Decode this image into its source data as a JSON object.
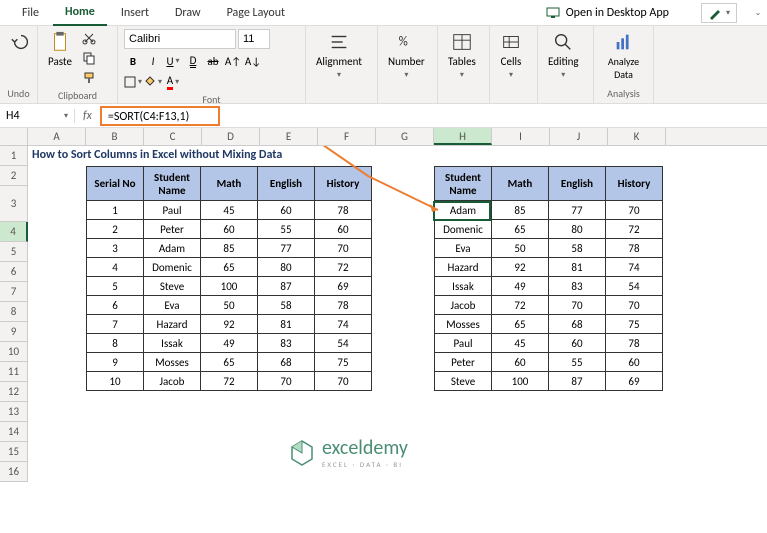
{
  "tabs": [
    "File",
    "Home",
    "Insert",
    "Draw",
    "Page Layout"
  ],
  "active_tab": "Home",
  "desktop_app": "Open in Desktop App",
  "ribbon": {
    "undo": "Undo",
    "clipboard": "Clipboard",
    "paste": "Paste",
    "font_group": "Font",
    "font_name": "Calibri",
    "font_size": "11",
    "alignment": "Alignment",
    "number": "Number",
    "tables": "Tables",
    "cells": "Cells",
    "editing": "Editing",
    "analyze": "Analyze Data",
    "analysis": "Analysis"
  },
  "name_box": "H4",
  "fx": "fx",
  "formula": "=SORT(C4:F13,1)",
  "columns": [
    "A",
    "B",
    "C",
    "D",
    "E",
    "F",
    "G",
    "H",
    "I",
    "J",
    "K"
  ],
  "rows": [
    "1",
    "2",
    "3",
    "4",
    "5",
    "6",
    "7",
    "8",
    "9",
    "10",
    "11",
    "12",
    "13",
    "14",
    "15",
    "16"
  ],
  "title": "How to Sort Columns in Excel without Mixing Data",
  "left_headers": [
    "Serial No",
    "Student Name",
    "Math",
    "English",
    "History"
  ],
  "right_headers": [
    "Student Name",
    "Math",
    "English",
    "History"
  ],
  "left_data": [
    [
      "1",
      "Paul",
      "45",
      "60",
      "78"
    ],
    [
      "2",
      "Peter",
      "60",
      "55",
      "60"
    ],
    [
      "3",
      "Adam",
      "85",
      "77",
      "70"
    ],
    [
      "4",
      "Domenic",
      "65",
      "80",
      "72"
    ],
    [
      "5",
      "Steve",
      "100",
      "87",
      "69"
    ],
    [
      "6",
      "Eva",
      "50",
      "58",
      "78"
    ],
    [
      "7",
      "Hazard",
      "92",
      "81",
      "74"
    ],
    [
      "8",
      "Issak",
      "49",
      "83",
      "54"
    ],
    [
      "9",
      "Mosses",
      "65",
      "68",
      "75"
    ],
    [
      "10",
      "Jacob",
      "72",
      "70",
      "70"
    ]
  ],
  "right_data": [
    [
      "Adam",
      "85",
      "77",
      "70"
    ],
    [
      "Domenic",
      "65",
      "80",
      "72"
    ],
    [
      "Eva",
      "50",
      "58",
      "78"
    ],
    [
      "Hazard",
      "92",
      "81",
      "74"
    ],
    [
      "Issak",
      "49",
      "83",
      "54"
    ],
    [
      "Jacob",
      "72",
      "70",
      "70"
    ],
    [
      "Mosses",
      "65",
      "68",
      "75"
    ],
    [
      "Paul",
      "45",
      "60",
      "78"
    ],
    [
      "Peter",
      "60",
      "55",
      "60"
    ],
    [
      "Steve",
      "100",
      "87",
      "69"
    ]
  ],
  "logo": {
    "name": "exceldemy",
    "sub": "EXCEL · DATA · BI"
  },
  "chart_data": {
    "type": "table",
    "title": "How to Sort Columns in Excel without Mixing Data",
    "source_range": "C4:F13",
    "formula": "=SORT(C4:F13,1)",
    "original": {
      "columns": [
        "Serial No",
        "Student Name",
        "Math",
        "English",
        "History"
      ],
      "rows": [
        [
          1,
          "Paul",
          45,
          60,
          78
        ],
        [
          2,
          "Peter",
          60,
          55,
          60
        ],
        [
          3,
          "Adam",
          85,
          77,
          70
        ],
        [
          4,
          "Domenic",
          65,
          80,
          72
        ],
        [
          5,
          "Steve",
          100,
          87,
          69
        ],
        [
          6,
          "Eva",
          50,
          58,
          78
        ],
        [
          7,
          "Hazard",
          92,
          81,
          74
        ],
        [
          8,
          "Issak",
          49,
          83,
          54
        ],
        [
          9,
          "Mosses",
          65,
          68,
          75
        ],
        [
          10,
          "Jacob",
          72,
          70,
          70
        ]
      ]
    },
    "sorted": {
      "columns": [
        "Student Name",
        "Math",
        "English",
        "History"
      ],
      "rows": [
        [
          "Adam",
          85,
          77,
          70
        ],
        [
          "Domenic",
          65,
          80,
          72
        ],
        [
          "Eva",
          50,
          58,
          78
        ],
        [
          "Hazard",
          92,
          81,
          74
        ],
        [
          "Issak",
          49,
          83,
          54
        ],
        [
          "Jacob",
          72,
          70,
          70
        ],
        [
          "Mosses",
          65,
          68,
          75
        ],
        [
          "Paul",
          45,
          60,
          78
        ],
        [
          "Peter",
          60,
          55,
          60
        ],
        [
          "Steve",
          100,
          87,
          69
        ]
      ]
    }
  }
}
